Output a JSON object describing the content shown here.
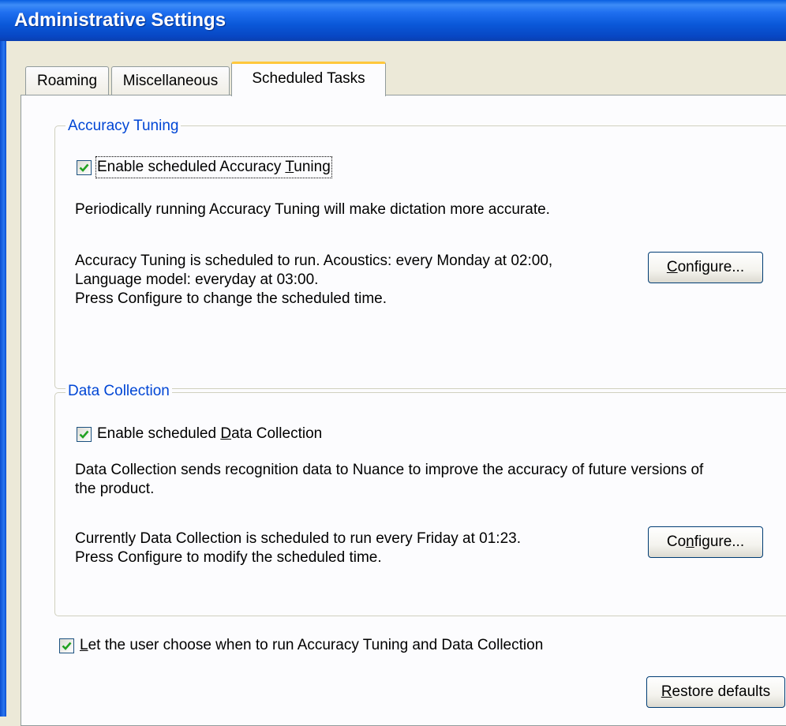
{
  "window": {
    "title": "Administrative Settings"
  },
  "tabs": [
    {
      "label": "Roaming"
    },
    {
      "label": "Miscellaneous"
    },
    {
      "label": "Scheduled Tasks",
      "active": true
    }
  ],
  "accuracy_tuning": {
    "legend": "Accuracy Tuning",
    "enable_label_pre": "Enable scheduled Accuracy ",
    "enable_label_key": "T",
    "enable_label_post": "uning",
    "enabled": true,
    "description": "Periodically running Accuracy Tuning will make dictation more accurate.",
    "schedule_line1": "Accuracy Tuning is scheduled to run. Acoustics: every Monday at 02:00,",
    "schedule_line2": "Language model: everyday at 03:00.",
    "schedule_line3": "Press Configure to change the scheduled time.",
    "configure_key": "C",
    "configure_rest": "onfigure..."
  },
  "data_collection": {
    "legend": "Data Collection",
    "enable_label_pre": "Enable scheduled ",
    "enable_label_key": "D",
    "enable_label_post": "ata Collection",
    "enabled": true,
    "description_line1": "Data Collection sends recognition data to Nuance to improve the accuracy of future versions of",
    "description_line2": "the product.",
    "schedule_line1": "Currently Data Collection is scheduled to run every Friday at 01:23.",
    "schedule_line2": "Press Configure to modify the scheduled time.",
    "configure_pre": "Co",
    "configure_key": "n",
    "configure_rest": "figure..."
  },
  "user_choice": {
    "label_key": "L",
    "label_rest": "et the user choose when to run Accuracy Tuning and Data Collection",
    "checked": true
  },
  "restore": {
    "key": "R",
    "rest": "estore defaults"
  },
  "colors": {
    "titlebar": "#0a58d8",
    "legend": "#0046d5",
    "check": "#21a121",
    "tab_highlight": "#ffc83c"
  }
}
